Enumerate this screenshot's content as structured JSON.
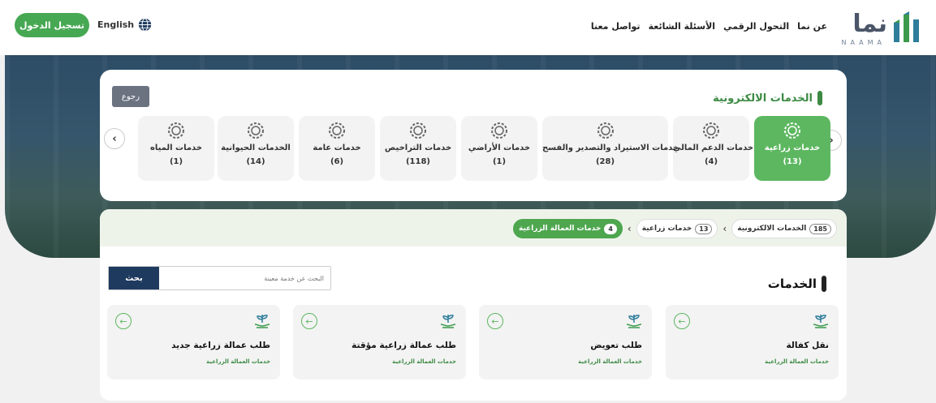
{
  "header": {
    "logo_ar": "نما",
    "logo_en": "NAAMA",
    "nav": [
      "عن نما",
      "التحول الرقمي",
      "الأسئلة الشائعة",
      "تواصل معنا"
    ],
    "lang": "English",
    "login": "تسجيل الدخول"
  },
  "eservices": {
    "title": "الخدمات الالكترونية",
    "back": "رجوع",
    "categories": [
      {
        "name": "خدمات زراعية",
        "count": "(13)"
      },
      {
        "name": "خدمات الدعم المالي",
        "count": "(4)"
      },
      {
        "name": "خدمات الاستيراد والتصدير والفسح",
        "count": "(28)"
      },
      {
        "name": "خدمات الأراضي",
        "count": "(1)"
      },
      {
        "name": "خدمات التراخيص",
        "count": "(118)"
      },
      {
        "name": "خدمات عامة",
        "count": "(6)"
      },
      {
        "name": "الخدمات الحيوانية",
        "count": "(14)"
      },
      {
        "name": "خدمات المياه",
        "count": "(1)"
      }
    ]
  },
  "breadcrumbs": [
    {
      "label": "الخدمات الالكترونية",
      "badge": "185"
    },
    {
      "label": "خدمات زراعية",
      "badge": "13"
    },
    {
      "label": "خدمات العمالة الزراعية",
      "badge": "4"
    }
  ],
  "services": {
    "title": "الخدمات",
    "search_button": "بحث",
    "search_placeholder": "البحث عن خدمة معينة",
    "cards": [
      {
        "title": "نقل كفالة",
        "sub": "خدمات العمالة الزراعية"
      },
      {
        "title": "طلب تعويض",
        "sub": "خدمات العمالة الزراعية"
      },
      {
        "title": "طلب عمالة زراعية مؤقتة",
        "sub": "خدمات العمالة الزراعية"
      },
      {
        "title": "طلب عمالة زراعية جديد",
        "sub": "خدمات العمالة الزراعية"
      }
    ]
  },
  "colors": {
    "accent": "#5db760",
    "navy": "#1e3a5f"
  }
}
